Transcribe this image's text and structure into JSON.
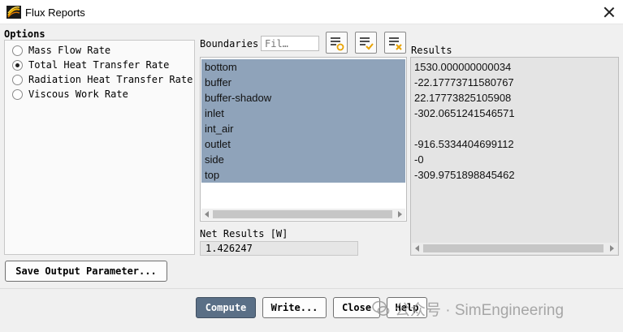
{
  "window": {
    "title": "Flux Reports"
  },
  "options": {
    "heading": "Options",
    "items": [
      {
        "label": "Mass Flow Rate",
        "selected": false
      },
      {
        "label": "Total Heat Transfer Rate",
        "selected": true
      },
      {
        "label": "Radiation Heat Transfer Rate",
        "selected": false
      },
      {
        "label": "Viscous Work Rate",
        "selected": false
      }
    ]
  },
  "boundaries": {
    "heading": "Boundaries",
    "filter_placeholder": "Fil…",
    "items": [
      {
        "label": "bottom",
        "selected": true
      },
      {
        "label": "buffer",
        "selected": true
      },
      {
        "label": "buffer-shadow",
        "selected": true
      },
      {
        "label": "inlet",
        "selected": true
      },
      {
        "label": "int_air",
        "selected": true
      },
      {
        "label": "outlet",
        "selected": true
      },
      {
        "label": "side",
        "selected": true
      },
      {
        "label": "top",
        "selected": true
      }
    ],
    "select_color": "#8fa3ba"
  },
  "results": {
    "heading": "Results",
    "values": [
      "1530.000000000034",
      "-22.17773711580767",
      "22.17773825105908",
      "-302.0651241546571",
      "",
      "-916.5334404699112",
      "-0",
      "-309.9751898845462"
    ]
  },
  "net": {
    "label": "Net Results [W]",
    "value": "1.426247"
  },
  "buttons": {
    "save_param": "Save Output Parameter...",
    "compute": "Compute",
    "write": "Write...",
    "close": "Close",
    "help": "Help"
  },
  "watermark": {
    "text": "公众号 · SimEngineering"
  },
  "colors": {
    "accent": "#5a6f86",
    "selection": "#8fa3ba"
  }
}
